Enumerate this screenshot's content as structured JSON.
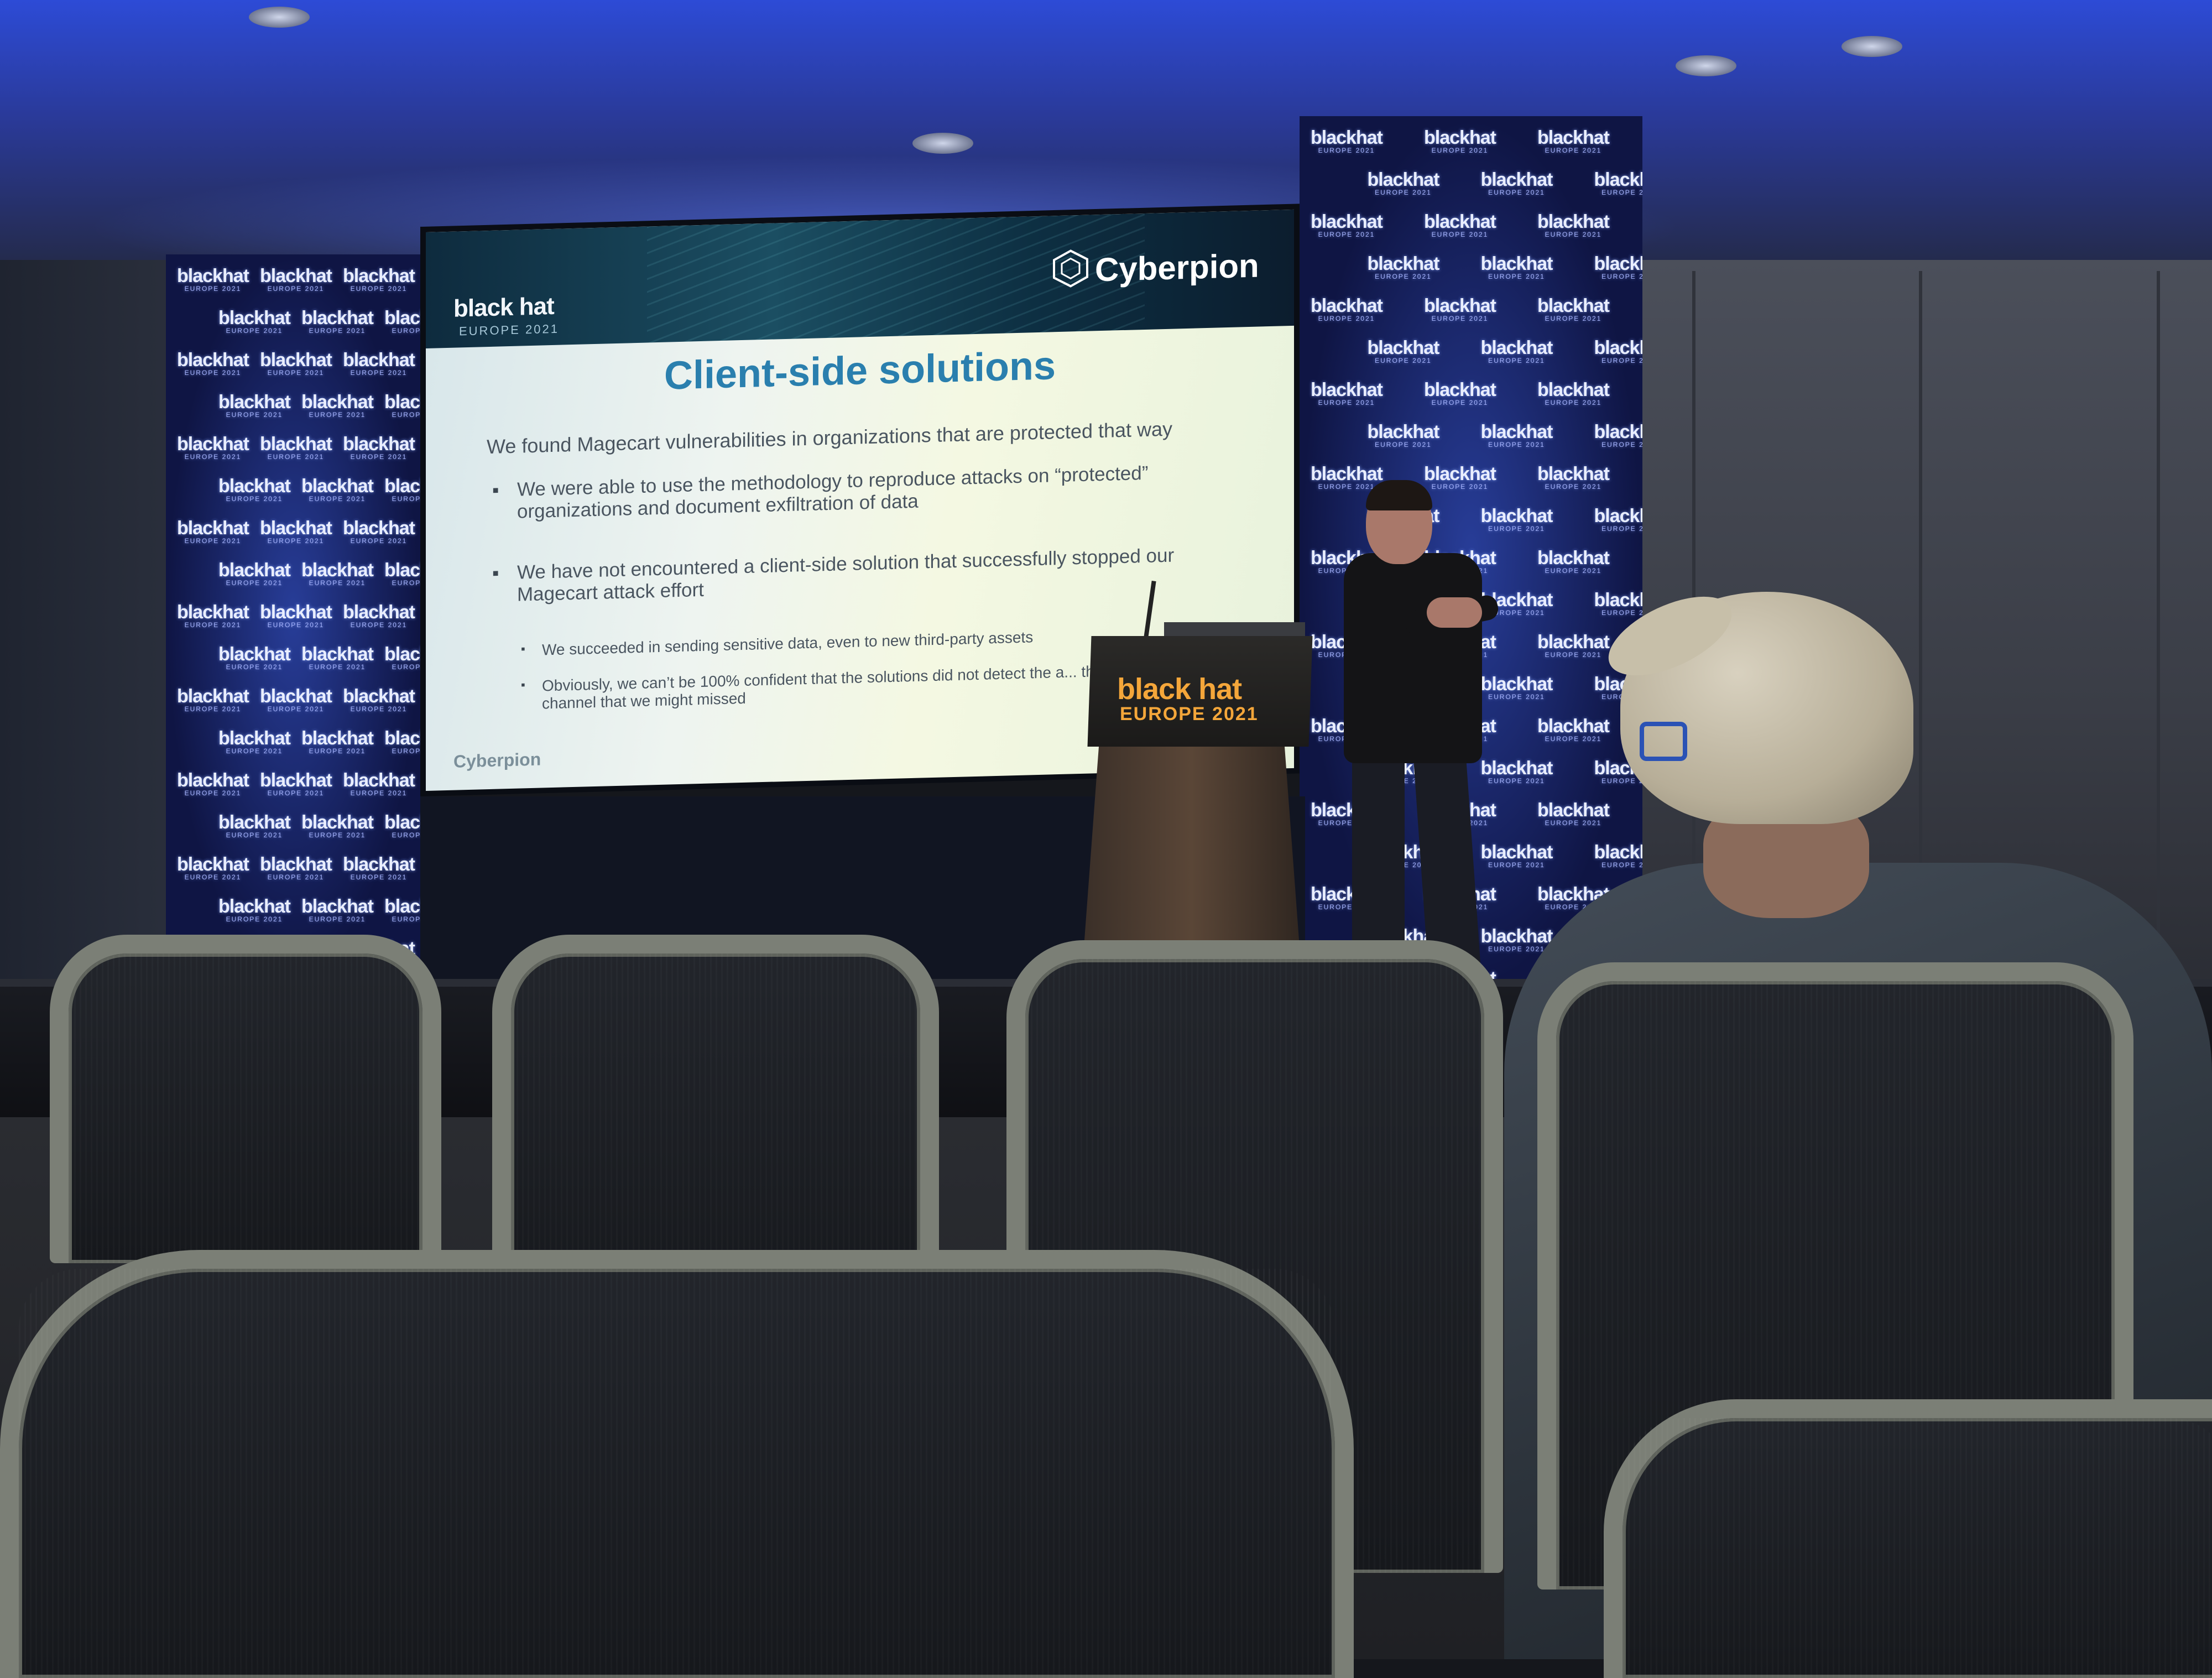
{
  "scene": {
    "backdrop_logo": "blackhat",
    "backdrop_logo_sub": "EUROPE 2021"
  },
  "slide": {
    "event_logo": "black hat",
    "event_sub": "EUROPE 2021",
    "brand": "Cyberpion",
    "title": "Client-side solutions",
    "intro": "We found Magecart vulnerabilities in organizations that are protected that way",
    "bullets": [
      "We were able to use the methodology to reproduce attacks on “protected” organizations and document exfiltration of data",
      "We have not encountered a client-side solution that successfully stopped our Magecart attack effort"
    ],
    "sub_bullets": [
      "We succeeded in sending sensitive data, even to new third-party assets",
      "Obviously, we can’t be 100% confident that the solutions did not detect the a... through a channel that we might missed"
    ],
    "footer_brand": "Cyberpion"
  },
  "lectern": {
    "logo": "black hat",
    "sub": "EUROPE 2021"
  },
  "colors": {
    "slide_title": "#2a7fae",
    "lectern_logo": "#f4a63a",
    "backdrop": "#0f1544",
    "ceiling_light": "#2d4bd6"
  }
}
